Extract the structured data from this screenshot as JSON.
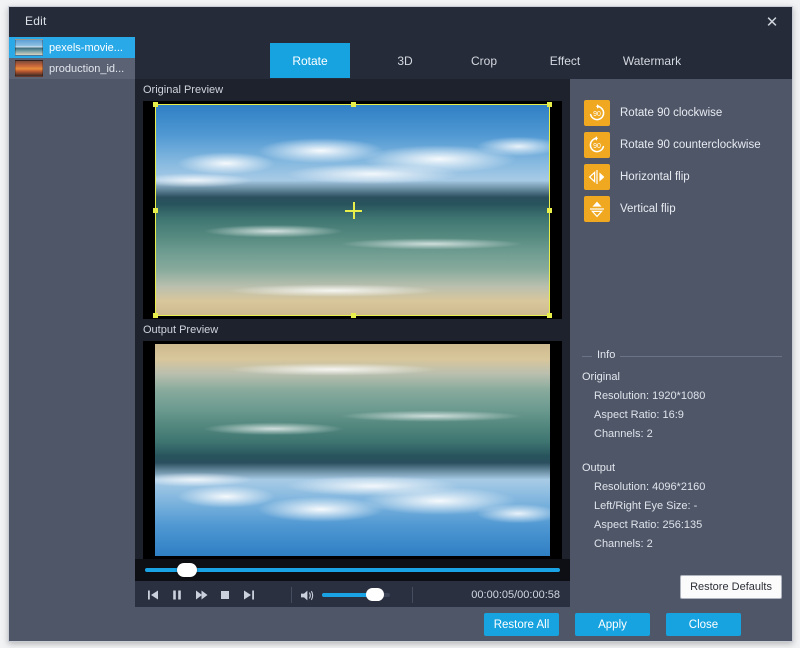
{
  "window": {
    "title": "Edit",
    "close_icon": "close-icon",
    "close_label": "✕"
  },
  "sidebar": {
    "files": [
      {
        "label": "pexels-movie...",
        "thumb": "sea-thumbnail",
        "selected": true
      },
      {
        "label": "production_id...",
        "thumb": "sunset-thumbnail",
        "selected": false
      }
    ]
  },
  "tabs": [
    {
      "label": "Rotate",
      "active": true
    },
    {
      "label": "3D",
      "active": false
    },
    {
      "label": "Crop",
      "active": false
    },
    {
      "label": "Effect",
      "active": false
    },
    {
      "label": "Watermark",
      "active": false
    }
  ],
  "preview": {
    "original_label": "Original Preview",
    "output_label": "Output Preview"
  },
  "transport": {
    "seek_percent": 10,
    "buttons": [
      {
        "name": "previous-button",
        "glyph": "⏮"
      },
      {
        "name": "pause-button",
        "glyph": "⏸"
      },
      {
        "name": "fast-forward-button",
        "glyph": "⏩"
      },
      {
        "name": "stop-button",
        "glyph": "⏹"
      },
      {
        "name": "next-button",
        "glyph": "⏭"
      }
    ],
    "volume_icon": "volume-icon",
    "volume_percent": 78,
    "timecode": "00:00:05/00:00:58"
  },
  "rotate_options": [
    {
      "label": "Rotate 90 clockwise",
      "icon": "rotate-clockwise-icon",
      "badge": "90"
    },
    {
      "label": "Rotate 90 counterclockwise",
      "icon": "rotate-counterclockwise-icon",
      "badge": "90"
    },
    {
      "label": "Horizontal flip",
      "icon": "horizontal-flip-icon",
      "badge": ""
    },
    {
      "label": "Vertical flip",
      "icon": "vertical-flip-icon",
      "badge": ""
    }
  ],
  "info": {
    "legend": "Info",
    "original_heading": "Original",
    "original_rows": [
      "Resolution: 1920*1080",
      "Aspect Ratio: 16:9",
      "Channels: 2"
    ],
    "output_heading": "Output",
    "output_rows": [
      "Resolution: 4096*2160",
      "Left/Right Eye Size: -",
      "Aspect Ratio: 256:135",
      "Channels: 2"
    ]
  },
  "buttons": {
    "restore_defaults": "Restore Defaults",
    "restore_all": "Restore All",
    "apply": "Apply",
    "close": "Close"
  },
  "colors": {
    "accent": "#17a3e0",
    "icon_orange": "#efa820",
    "panel": "#4f5668",
    "dark": "#252b38",
    "crop_border": "#e8ef4a"
  }
}
